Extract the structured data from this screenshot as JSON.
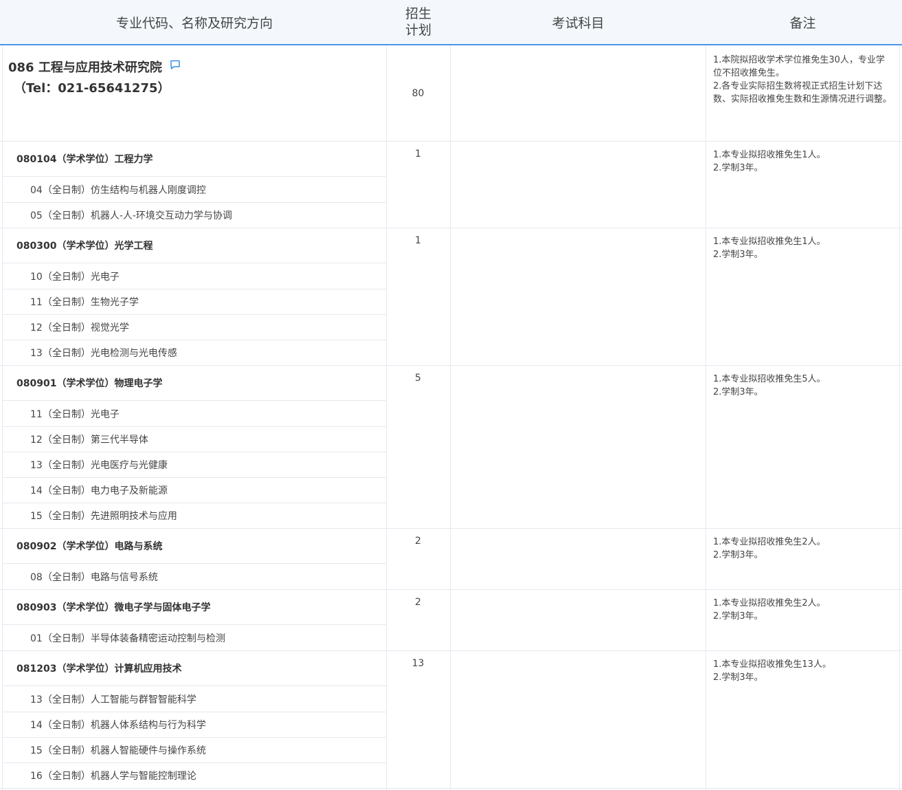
{
  "header": {
    "col_major": "专业代码、名称及研究方向",
    "col_plan_line1": "招生",
    "col_plan_line2": "计划",
    "col_exam": "考试科目",
    "col_note": "备注"
  },
  "college": {
    "name": "086 工程与应用技术研究院",
    "tel": "（Tel：021-65641275）",
    "plan": "80",
    "note": "1.本院拟招收学术学位推免生30人，专业学位不招收推免生。\n2.各专业实际招生数将视正式招生计划下达数、实际招收推免生数和生源情况进行调整。"
  },
  "groups": [
    {
      "major": "080104（学术学位）工程力学",
      "plan": "1",
      "note": "1.本专业拟招收推免生1人。\n2.学制3年。",
      "directions": [
        "04（全日制）仿生结构与机器人刚度调控",
        "05（全日制）机器人-人-环境交互动力学与协调"
      ]
    },
    {
      "major": "080300（学术学位）光学工程",
      "plan": "1",
      "note": "1.本专业拟招收推免生1人。\n2.学制3年。",
      "directions": [
        "10（全日制）光电子",
        "11（全日制）生物光子学",
        "12（全日制）视觉光学",
        "13（全日制）光电检测与光电传感"
      ]
    },
    {
      "major": "080901（学术学位）物理电子学",
      "plan": "5",
      "note": "1.本专业拟招收推免生5人。\n2.学制3年。",
      "directions": [
        "11（全日制）光电子",
        "12（全日制）第三代半导体",
        "13（全日制）光电医疗与光健康",
        "14（全日制）电力电子及新能源",
        "15（全日制）先进照明技术与应用"
      ]
    },
    {
      "major": "080902（学术学位）电路与系统",
      "plan": "2",
      "note": "1.本专业拟招收推免生2人。\n2.学制3年。",
      "directions": [
        "08（全日制）电路与信号系统"
      ]
    },
    {
      "major": "080903（学术学位）微电子学与固体电子学",
      "plan": "2",
      "note": "1.本专业拟招收推免生2人。\n2.学制3年。",
      "directions": [
        "01（全日制）半导体装备精密运动控制与检测"
      ]
    },
    {
      "major": "081203（学术学位）计算机应用技术",
      "plan": "13",
      "note": "1.本专业拟招收推免生13人。\n2.学制3年。",
      "directions": [
        "13（全日制）人工智能与群智智能科学",
        "14（全日制）机器人体系结构与行为科学",
        "15（全日制）机器人智能硬件与操作系统",
        "16（全日制）机器人学与智能控制理论"
      ]
    }
  ]
}
